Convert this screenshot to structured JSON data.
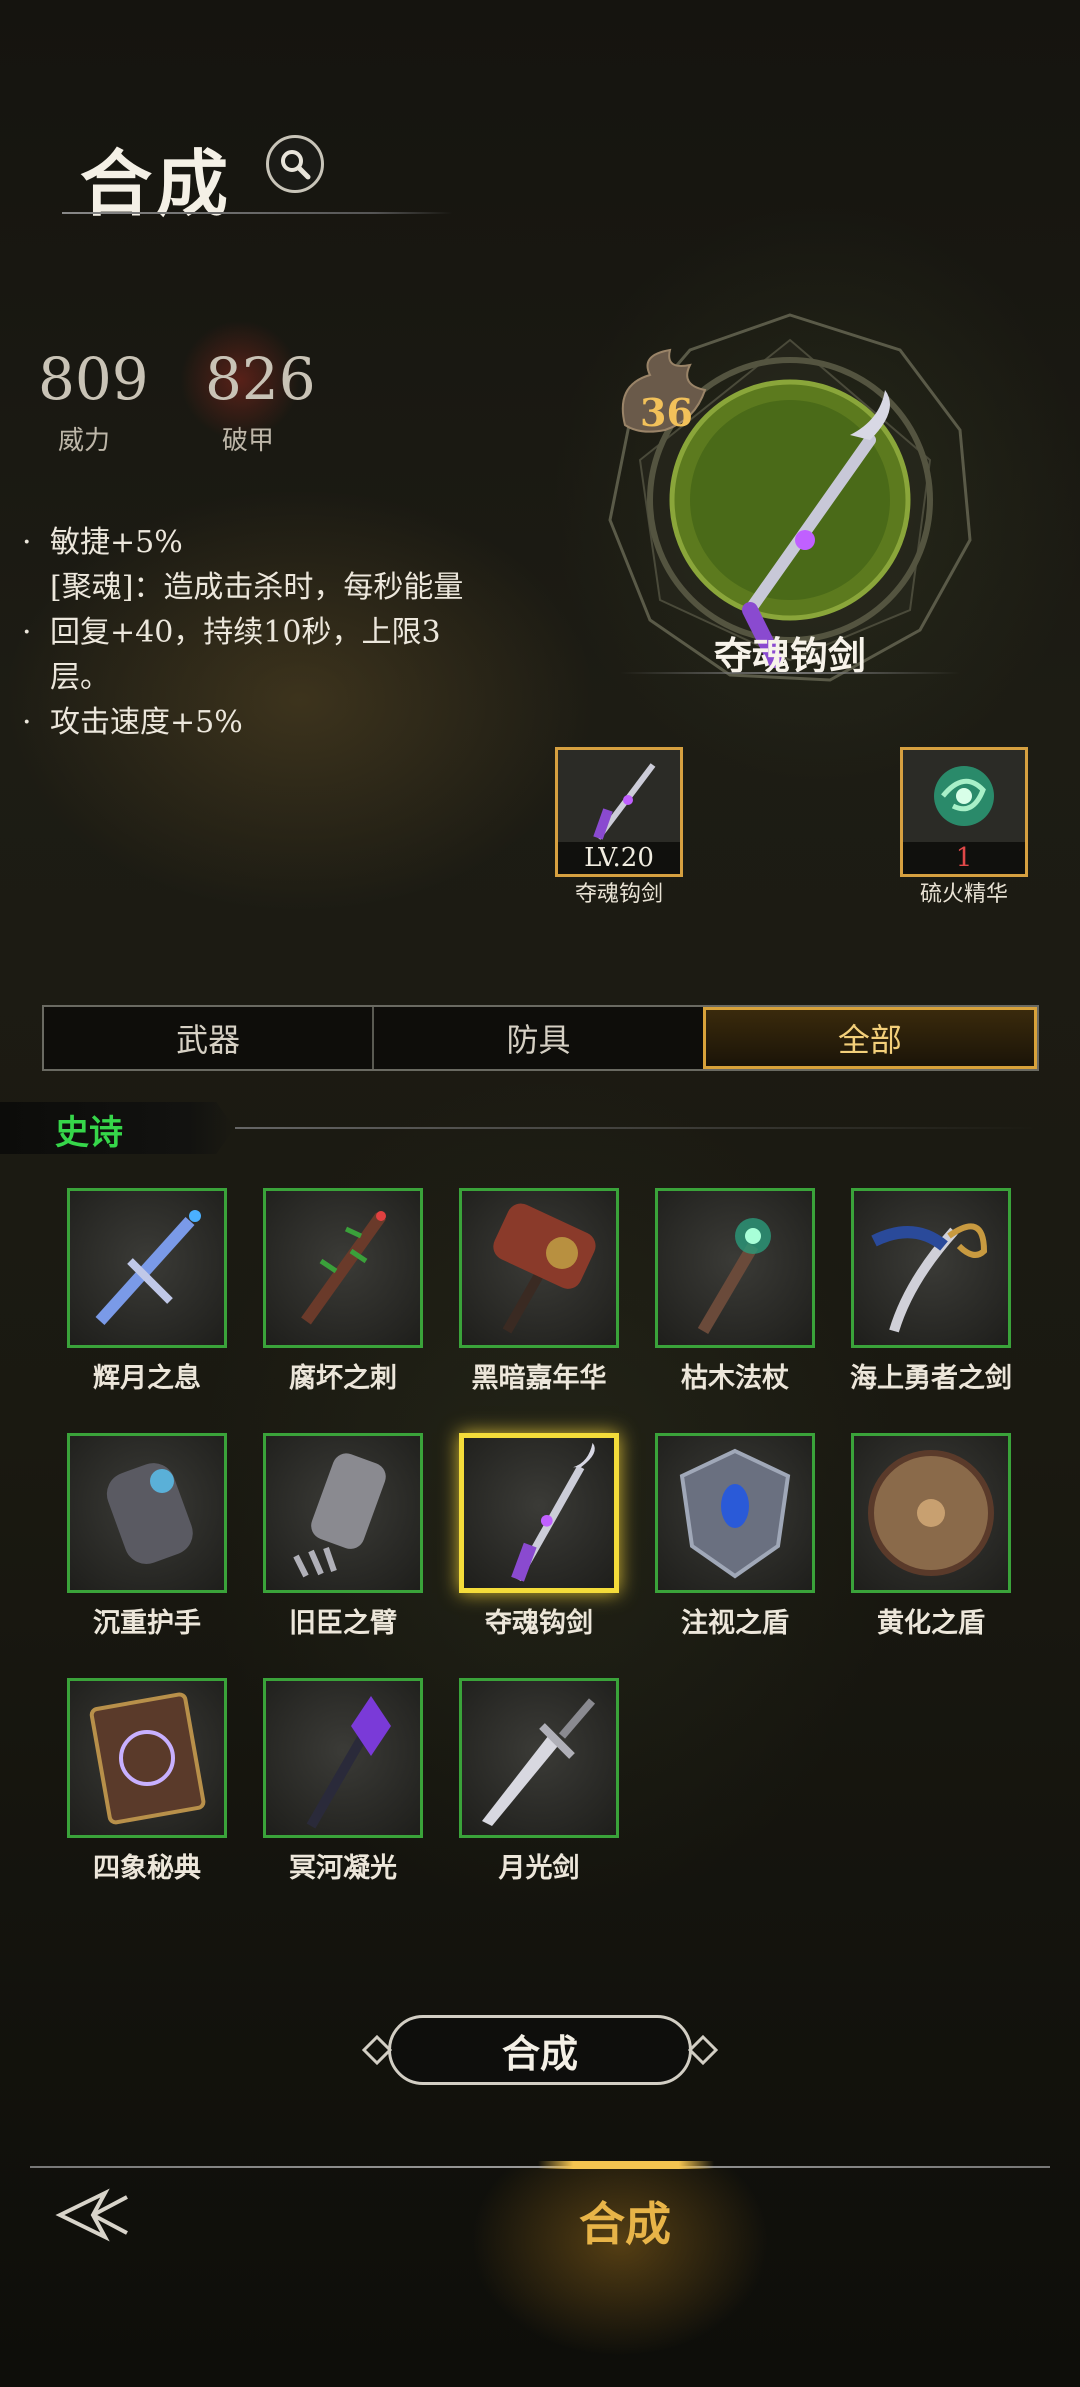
{
  "header": {
    "title": "合成",
    "search_icon": "magnifier-icon"
  },
  "stats": [
    {
      "value": "809",
      "label": "威力"
    },
    {
      "value": "826",
      "label": "破甲"
    }
  ],
  "description": [
    {
      "bullet": "·",
      "text": "敏捷+5%"
    },
    {
      "bullet": "",
      "text": "[聚魂]：造成击杀时，每秒能量"
    },
    {
      "bullet": "·",
      "text": "回复+40，持续10秒，上限3"
    },
    {
      "bullet": "",
      "text": "层。"
    },
    {
      "bullet": "·",
      "text": "攻击速度+5%"
    }
  ],
  "selected_item": {
    "level": "36",
    "name": "夺魂钩剑"
  },
  "materials": [
    {
      "caption": "LV.20",
      "name": "夺魂钩剑",
      "icon": "hook-sword-icon"
    },
    {
      "caption": "1",
      "name": "硫火精华",
      "icon": "green-swirl-essence-icon"
    }
  ],
  "tabs": [
    {
      "label": "武器",
      "active": false
    },
    {
      "label": "防具",
      "active": false
    },
    {
      "label": "全部",
      "active": true
    }
  ],
  "section": {
    "title": "史诗"
  },
  "items": [
    {
      "name": "辉月之息",
      "icon": "blue-greatsword-icon"
    },
    {
      "name": "腐坏之刺",
      "icon": "thorn-staff-icon"
    },
    {
      "name": "黑暗嘉年华",
      "icon": "hammer-icon"
    },
    {
      "name": "枯木法杖",
      "icon": "wood-staff-icon"
    },
    {
      "name": "海上勇者之剑",
      "icon": "sabre-icon"
    },
    {
      "name": "沉重护手",
      "icon": "gauntlet-icon"
    },
    {
      "name": "旧臣之臂",
      "icon": "claw-gauntlet-icon"
    },
    {
      "name": "夺魂钩剑",
      "icon": "hook-sword-icon",
      "selected": true
    },
    {
      "name": "注视之盾",
      "icon": "eye-shield-icon"
    },
    {
      "name": "黄化之盾",
      "icon": "round-shield-icon"
    },
    {
      "name": "四象秘典",
      "icon": "tome-icon"
    },
    {
      "name": "冥河凝光",
      "icon": "crystal-mace-icon"
    },
    {
      "name": "月光剑",
      "icon": "moonlight-sword-icon"
    }
  ],
  "craft_button": {
    "label": "合成"
  },
  "bottom_nav": {
    "back_icon": "back-arrow-icon",
    "active_label": "合成"
  },
  "colors": {
    "epic_border": "#3aa33a",
    "selected_border": "#f4dc3a",
    "accent_gold": "#d8a23a",
    "section_green": "#36d64a"
  }
}
